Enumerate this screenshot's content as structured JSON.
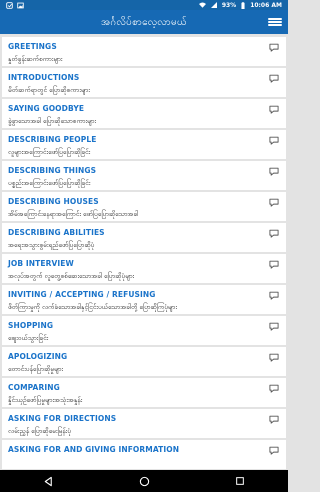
{
  "status_bar": {
    "battery": "93%",
    "time": "10:06 AM"
  },
  "app_bar": {
    "title": "အင်္ဂလိပ်စာလေ့လာမယ်"
  },
  "topics": [
    {
      "title": "GREETINGS",
      "subtitle": "နှုတ်ခွန်းဆက်စကားများ"
    },
    {
      "title": "INTRODUCTIONS",
      "subtitle": "မိတ်ဆက်ရာတွင် ပြောဆိုစကားများ"
    },
    {
      "title": "SAYING GOODBYE",
      "subtitle": "ခွဲခွာသောအခါ ပြောဆိုသောစကားများ"
    },
    {
      "title": "DESCRIBING PEOPLE",
      "subtitle": "လူများအကြောင်းဖော်ပြပြောဆိုခြင်း"
    },
    {
      "title": "DESCRIBING THINGS",
      "subtitle": "ပစ္စည်းအကြောင်းဖော်ပြပြောဆိုခြင်း"
    },
    {
      "title": "DESCRIBING HOUSES",
      "subtitle": "အိမ်အကြောင်းနေရာအကြောင်း ဖော်ပြပြောဆိုသောအခါ"
    },
    {
      "title": "DESCRIBING ABILITIES",
      "subtitle": "အရေးအသွားစွမ်းရည်ဖော်ပြပြောဆိုပုံ"
    },
    {
      "title": "JOB INTERVIEW",
      "subtitle": "အလုပ်အတွက် လူတွေ့စစ်ဆေးသောအခါ ပြောဆိုပုံများ"
    },
    {
      "title": "INVITING / ACCEPTING / REFUSING",
      "subtitle": "ဖိတ်ကြားမှုကို လက်ခံသောအခါနှင့်ငြင်းပယ်သောအခါတို့ ပြောဆိုကြပုံများ"
    },
    {
      "title": "SHOPPING",
      "subtitle": "ဈေးဝယ်သွားခြင်း"
    },
    {
      "title": "APOLOGIZING",
      "subtitle": "တောင်းပန်ပြောဆိုမှုများ"
    },
    {
      "title": "COMPARING",
      "subtitle": "နှိုင်းယှဉ်ဖော်ပြမှုများအသုံးအနှုန်း"
    },
    {
      "title": "ASKING FOR DIRECTIONS",
      "subtitle": "လမ်းညွှန် ပြောဆိုမေးမြန်းပုံ"
    },
    {
      "title": "ASKING FOR AND GIVING INFORMATION",
      "subtitle": ""
    }
  ],
  "icons": {
    "list_item": "chat-bubble-icon",
    "menu": "hamburger-menu-icon"
  },
  "colors": {
    "app_bar": "#1669b4",
    "status_bar": "#1565a8",
    "title_text": "#1a73c9",
    "background": "#e3e3e3"
  }
}
